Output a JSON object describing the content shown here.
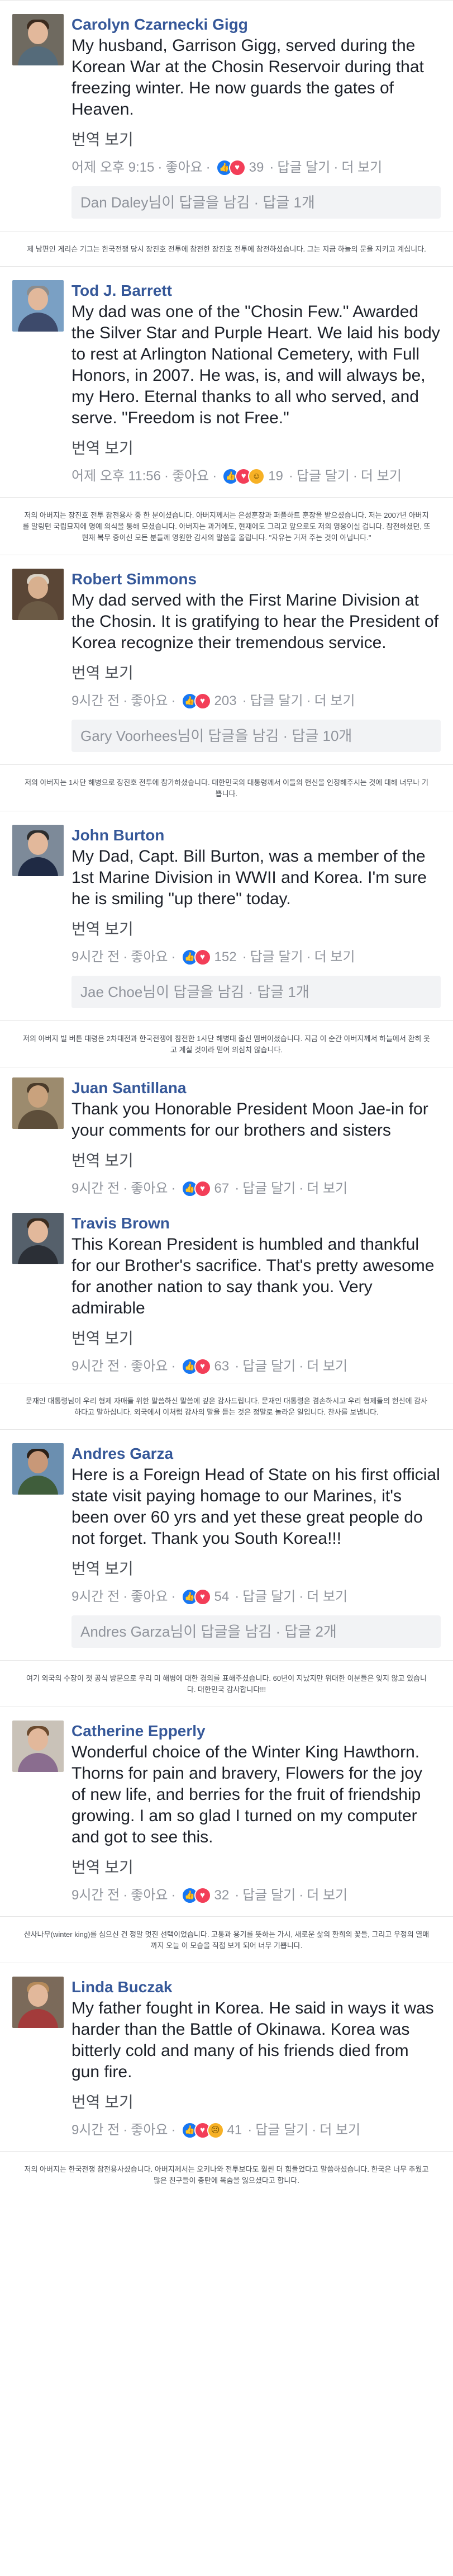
{
  "labels": {
    "translate": "번역 보기",
    "like": "좋아요",
    "reply": "답글 달기",
    "more": "더 보기"
  },
  "comments": [
    {
      "name": "Carolyn Czarnecki Gigg",
      "text": "My husband, Garrison Gigg, served during the Korean War at the Chosin Reservoir during that freezing winter. He now guards the gates of Heaven.",
      "time": "어제 오후 9:15",
      "reactions": [
        "like",
        "love"
      ],
      "count": "39",
      "replies": "Dan Daley님이 답글을 남김 · 답글 1개",
      "note": "제 남편인 게리슨 기그는 한국전쟁 당시 장진호 전투에 참전한 장진호 전투에 참전하셨습니다. 그는 지금 하늘의 문을 지키고 계십니다."
    },
    {
      "name": "Tod J. Barrett",
      "text": "My dad was one of the \"Chosin Few.\" Awarded the Silver Star and Purple Heart. We laid his body to rest at Arlington National Cemetery, with Full Honors, in 2007. He was, is, and will always be, my Hero. Eternal thanks to all who served, and serve. \"Freedom is not Free.\"",
      "time": "어제 오후 11:56",
      "reactions": [
        "like",
        "love",
        "wow"
      ],
      "count": "19",
      "replies": "",
      "note": "저의 아버지는 장진호 전투 참전용사 중 한 분이셨습니다. 아버지께서는 은성훈장과 퍼플하트 훈장을 받으셨습니다. 저는 2007년 아버지를 알링턴 국립묘지에 명예 의식을 통해 모셨습니다. 아버지는 과거에도, 현재에도 그리고 앞으로도 저의 영웅이실 겁니다. 참전하셨던, 또 현재 복무 중이신 모든 분들께 영원한 감사의 말씀을 올립니다. \"자유는 거저 주는 것이 아닙니다.\""
    },
    {
      "name": "Robert Simmons",
      "text": "My dad served with the First Marine Division at the Chosin. It is gratifying to hear the President of Korea recognize their tremendous service.",
      "time": "9시간 전",
      "reactions": [
        "like",
        "love"
      ],
      "count": "203",
      "replies": "Gary Voorhees님이 답글을 남김 · 답글 10개",
      "note": "저의 아버지는 1사단 해병으로 장진호 전투에 참가하셨습니다. 대한민국의 대통령께서 이들의 헌신을 인정해주시는 것에 대해 너무나 기쁩니다."
    },
    {
      "name": "John Burton",
      "text": "My Dad, Capt. Bill Burton, was a member of the 1st Marine Division in WWII and Korea. I'm sure he is smiling \"up there\" today.",
      "time": "9시간 전",
      "reactions": [
        "like",
        "love"
      ],
      "count": "152",
      "replies": "Jae Choe님이 답글을 남김 · 답글 1개",
      "note": "저의 아버지 빌 버튼 대령은 2차대전과 한국전쟁에 참전한 1사단 해병대 출신 멤버이셨습니다. 지금 이 순간 아버지께서 하늘에서 환히 웃고 계실 것이라 믿어 의심치 않습니다."
    },
    {
      "name": "Juan Santillana",
      "text": "Thank you Honorable President Moon Jae-in for your comments for our brothers and sisters",
      "time": "9시간 전",
      "reactions": [
        "like",
        "love"
      ],
      "count": "67",
      "replies": "",
      "note": ""
    },
    {
      "name": "Travis Brown",
      "text": "This Korean President is humbled and thankful for our Brother's sacrifice. That's pretty awesome for another nation to say thank you. Very admirable",
      "time": "9시간 전",
      "reactions": [
        "like",
        "love"
      ],
      "count": "63",
      "replies": "",
      "note": "문재인 대통령님이 우리 형제 자매들 위한 말씀하신 말씀에 깊은 감사드립니다. 문재인 대통령은 겸손하시고 우리 형제들의 헌신에 감사하다고 말하십니다. 외국에서 이처럼 감사의 말을 듣는 것은 정말로 놀라운 일입니다. 찬사를 보냅니다."
    },
    {
      "name": "Andres Garza",
      "text": "Here is a Foreign Head of State on his first official state visit paying homage to our Marines, it's been over 60 yrs and yet these great people do not forget. Thank you South Korea!!!",
      "time": "9시간 전",
      "reactions": [
        "like",
        "love"
      ],
      "count": "54",
      "replies": "Andres Garza님이 답글을 남김 · 답글 2개",
      "note": "여기 외국의 수장이 첫 공식 방문으로 우리 미 해병에 대한 경의를 표해주셨습니다. 60년이 지났지만 위대한 이분들은 잊지 않고 있습니다. 대한민국 감사합니다!!!"
    },
    {
      "name": "Catherine Epperly",
      "text": "Wonderful choice of the Winter King Hawthorn. Thorns for pain and bravery, Flowers for the joy of new life, and berries for the fruit of friendship growing. I am so glad I turned on my computer and got to see this.",
      "time": "9시간 전",
      "reactions": [
        "like",
        "love"
      ],
      "count": "32",
      "replies": "",
      "note": "산사나무(winter king)를 심으신 건 정말 멋진 선택이었습니다. 고통과 용기를 뜻하는 가시, 새로운 삶의 환희의 꽃들, 그리고 우정의 열매까지 오늘 이 모습을 직접 보게 되어 너무 기쁩니다."
    },
    {
      "name": "Linda Buczak",
      "text": "My father fought in Korea. He said in ways it was harder than the Battle of Okinawa. Korea was bitterly cold and many of his friends died from gun fire.",
      "time": "9시간 전",
      "reactions": [
        "like",
        "love",
        "sad"
      ],
      "count": "41",
      "replies": "",
      "note": "저의 아버지는 한국전쟁 참전용사셨습니다. 아버지께서는 오키나와 전투보다도 훨씬 더 힘들었다고 말씀하셨습니다. 한국은 너무 추웠고 많은 친구들이 총탄에 목숨을 잃으셨다고 합니다."
    }
  ],
  "colors": {
    "name_link": "#365899",
    "meta": "#90949c",
    "reply_box_bg": "#f2f3f5",
    "like": "#1877f2",
    "love": "#f33e58",
    "wow": "#f7b125"
  }
}
